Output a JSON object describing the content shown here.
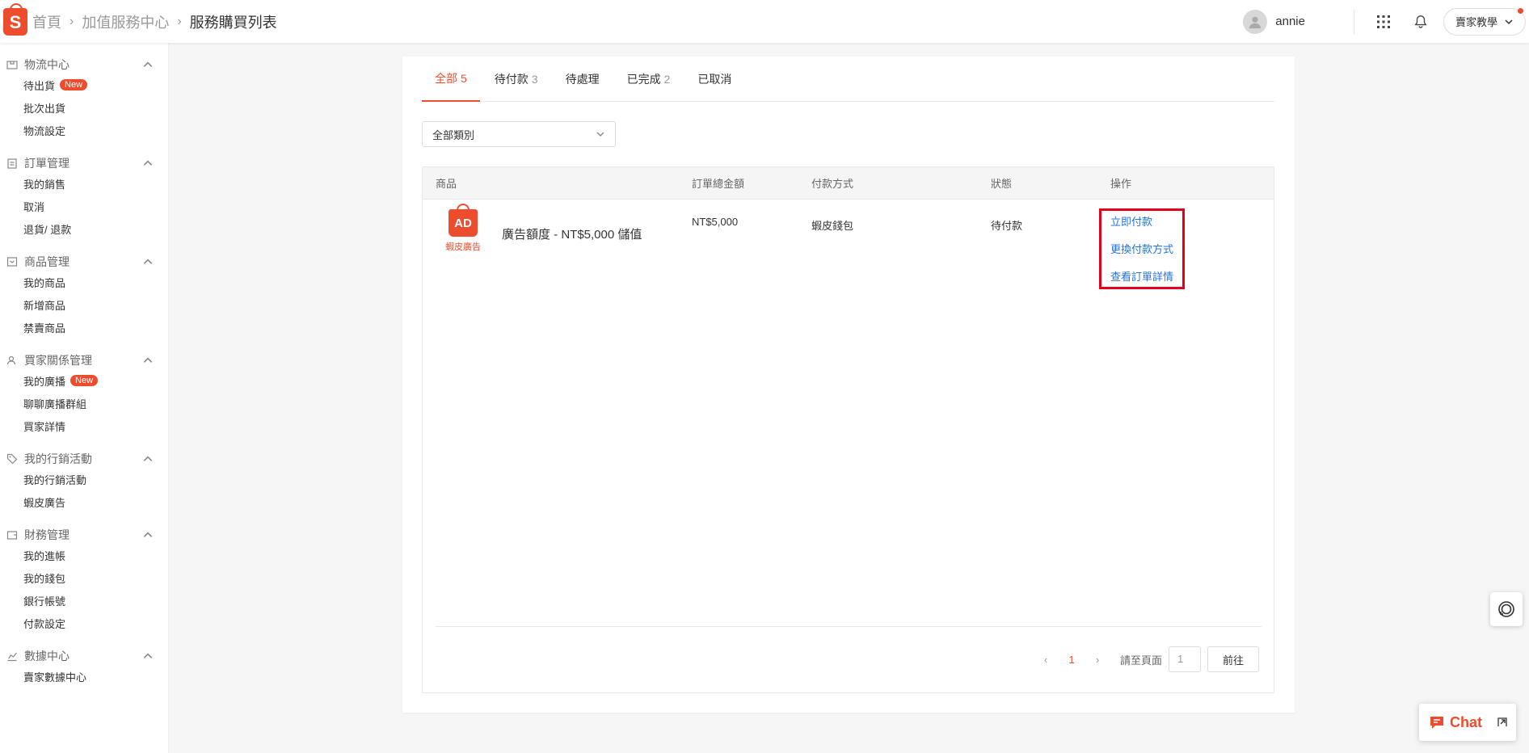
{
  "header": {
    "logo_letter": "S",
    "breadcrumb": [
      "首頁",
      "加值服務中心",
      "服務購買列表"
    ],
    "username": "annie",
    "seller_button": "賣家教學"
  },
  "sidebar": {
    "groups": [
      {
        "title": "物流中心",
        "items": [
          "待出貨",
          "批次出貨",
          "物流設定"
        ],
        "badge": "New"
      },
      {
        "title": "訂單管理",
        "items": [
          "我的銷售",
          "取消",
          "退貨/ 退款"
        ]
      },
      {
        "title": "商品管理",
        "items": [
          "我的商品",
          "新增商品",
          "禁賣商品"
        ]
      },
      {
        "title": "買家關係管理",
        "items": [
          "我的廣播",
          "聊聊廣播群組",
          "買家詳情"
        ],
        "badge": "New"
      },
      {
        "title": "我的行銷活動",
        "items": [
          "我的行銷活動",
          "蝦皮廣告"
        ]
      },
      {
        "title": "財務管理",
        "items": [
          "我的進帳",
          "我的錢包",
          "銀行帳號",
          "付款設定"
        ]
      },
      {
        "title": "數據中心",
        "items": [
          "賣家數據中心"
        ]
      }
    ]
  },
  "tabs": [
    {
      "label": "全部",
      "count": "5"
    },
    {
      "label": "待付款",
      "count": "3"
    },
    {
      "label": "待處理",
      "count": ""
    },
    {
      "label": "已完成",
      "count": "2"
    },
    {
      "label": "已取消",
      "count": ""
    }
  ],
  "filter": {
    "selected": "全部類別"
  },
  "table": {
    "headers": [
      "商品",
      "訂單總金額",
      "付款方式",
      "狀態",
      "操作"
    ],
    "rows": [
      {
        "icon_text": "AD",
        "icon_label": "蝦皮廣告",
        "product": "廣告額度 - NT$5,000 儲值",
        "amount": "NT$5,000",
        "payment": "蝦皮錢包",
        "status": "待付款",
        "actions": [
          "立即付款",
          "更換付款方式",
          "查看訂單詳情"
        ]
      }
    ]
  },
  "pagination": {
    "current_page": "1",
    "goto_label": "請至頁面",
    "goto_value": "1",
    "goto_button": "前往"
  },
  "chat": {
    "label": "Chat"
  },
  "colors": {
    "brand": "#ee4d2d",
    "link": "#2673dd",
    "highlight": "#e0001b"
  }
}
